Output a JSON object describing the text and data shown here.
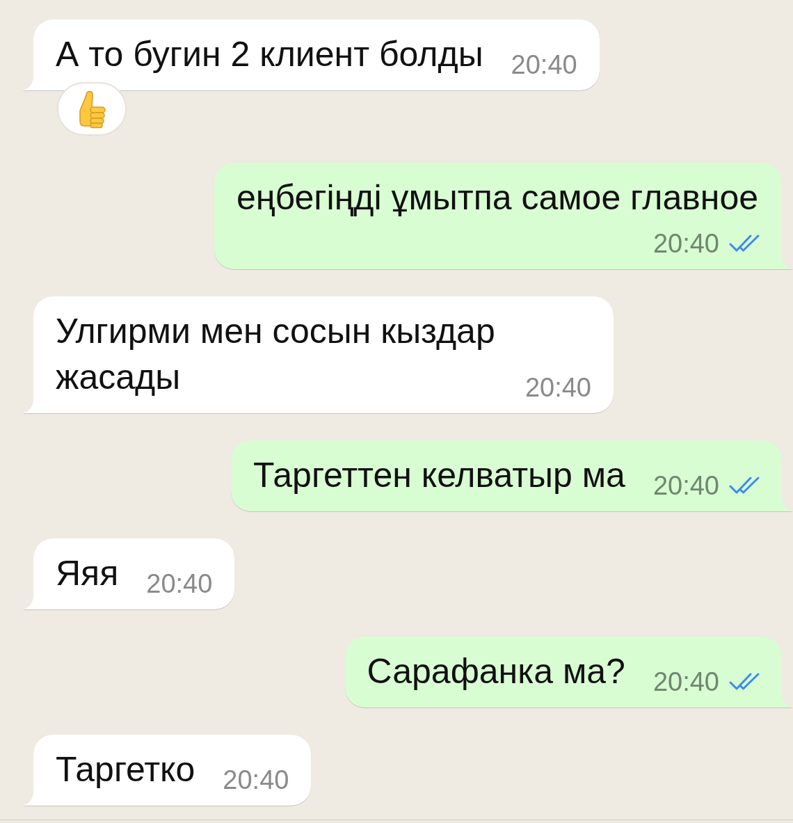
{
  "messages": [
    {
      "kind": "incoming",
      "text": "А то бугин 2 клиент болды",
      "time": "20:40",
      "reaction": {
        "kind": "thumbs_up"
      }
    },
    {
      "kind": "outgoing",
      "text": "еңбегіңді ұмытпа самое главное",
      "time": "20:40",
      "read": true
    },
    {
      "kind": "incoming",
      "text": "Улгирми мен сосын кыздар жасады",
      "time": "20:40"
    },
    {
      "kind": "outgoing",
      "text": "Таргеттен келватыр ма",
      "time": "20:40",
      "read": true
    },
    {
      "kind": "incoming",
      "text": "Яяя",
      "time": "20:40"
    },
    {
      "kind": "outgoing",
      "text": "Сарафанка ма?",
      "time": "20:40",
      "read": true
    },
    {
      "kind": "incoming",
      "text": "Таргетко",
      "time": "20:40"
    }
  ]
}
